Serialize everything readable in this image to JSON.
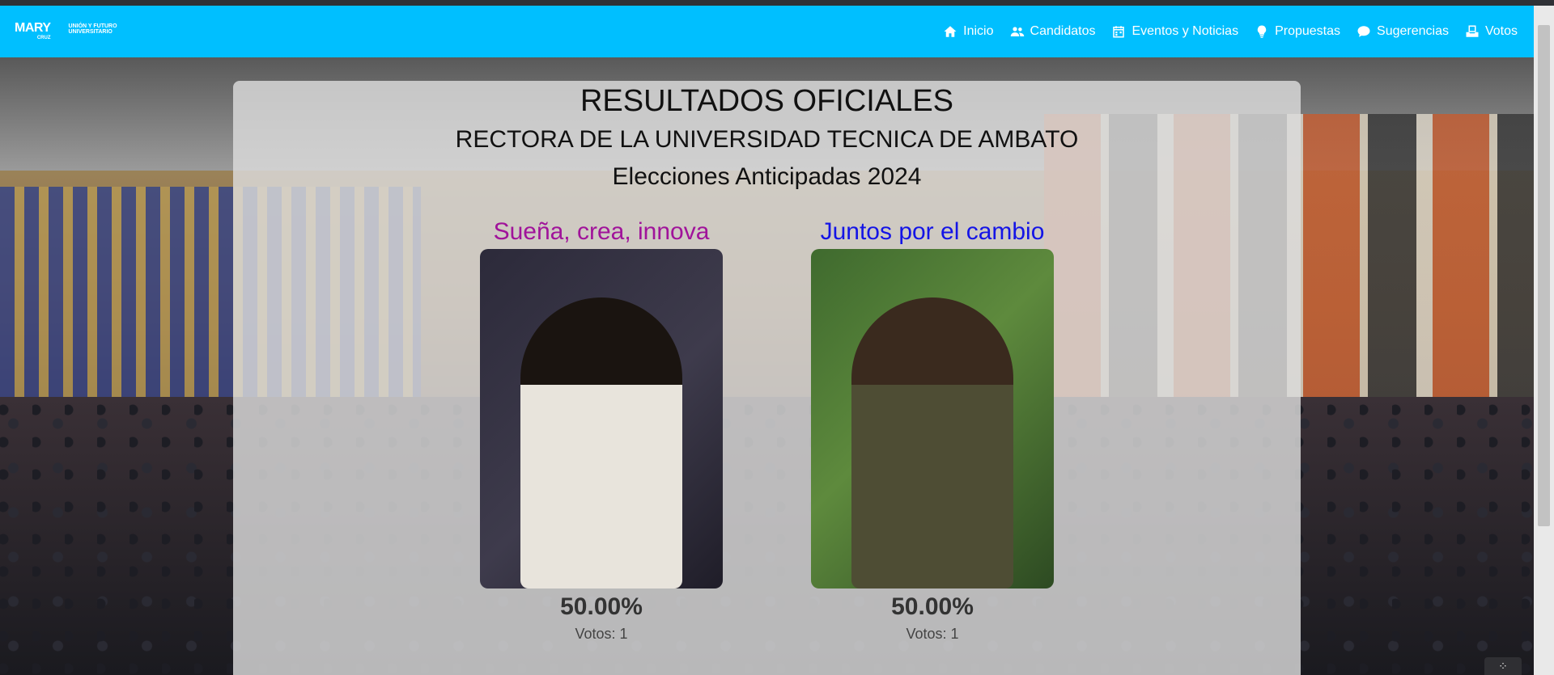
{
  "brand": {
    "name": "MARY",
    "sub": "CRUZ",
    "union_line1": "UNIÓN Y FUTURO",
    "union_line2": "UNIVERSITARIO"
  },
  "nav": {
    "items": [
      {
        "label": "Inicio",
        "icon": "home-icon"
      },
      {
        "label": "Candidatos",
        "icon": "users-icon"
      },
      {
        "label": "Eventos y Noticias",
        "icon": "calendar-icon"
      },
      {
        "label": "Propuestas",
        "icon": "lightbulb-icon"
      },
      {
        "label": "Sugerencias",
        "icon": "chat-icon"
      },
      {
        "label": "Votos",
        "icon": "ballot-icon"
      }
    ]
  },
  "results": {
    "title": "RESULTADOS OFICIALES",
    "subtitle": "RECTORA DE LA UNIVERSIDAD TECNICA DE AMBATO",
    "election": "Elecciones Anticipadas 2024",
    "candidates": [
      {
        "slogan": "Sueña, crea, innova",
        "slogan_color": "#a0139a",
        "percent": "50.00%",
        "votes": "Votos: 1"
      },
      {
        "slogan": "Juntos por el cambio",
        "slogan_color": "#1414e6",
        "percent": "50.00%",
        "votes": "Votos: 1"
      }
    ]
  },
  "colors": {
    "navbar": "#00bfff",
    "card": "#dcdcdc"
  }
}
